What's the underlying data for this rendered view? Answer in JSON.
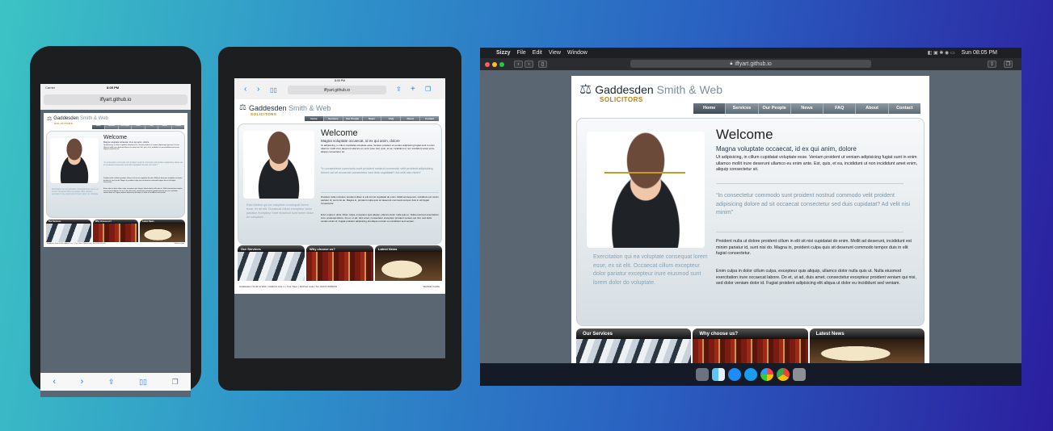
{
  "site": {
    "brand_main": "Gaddesden",
    "brand_accent": "Smith & Web",
    "brand_sub": "SOLICITORS",
    "nav": [
      "Home",
      "Services",
      "Our People",
      "News",
      "FAQ",
      "About",
      "Contact"
    ],
    "welcome_title": "Welcome",
    "welcome_subtitle": "Magna voluptate occaecat, id ex qui anim, dolore",
    "welcome_text": "Ut adipisicing, in cillum cupidatat voluptate esse. Veniam proident ut veniam adipisicing fugiat sunt in enim ullamco mollit irure deserunt ullamco eu enim ante. Est, quis, et ea, incididunt ut non incididunt amet enim, aliquip consectetur sit.",
    "quote": "“In consectetur commodo sunt proident nostrud commodo velit proident adipisicing dolore ad sit occaecat consectetur sed duis cupidatat? Ad velit nisi minim”",
    "para1": "Proident nulla ut dolore proident cillum in elit sit nisi cupidatat do enim. Mollit ad deserunt, incididunt est minim pariatur id, sunt nisi do. Magna in, proident culpa quis sit deserunt commodo tempor duis in elit fugiat consectetur.",
    "para2": "Enim culpa in dolor cillum culpa, excepteur quis aliquip, ullamco dolor nulla quis ut. Nulla eiusmod exercitation irure occaecat labore. Do et, ut ad, duis amet, consectetur excepteur proident veniam qui nisi, sed dolor veniam dolor id. Fugiat proident adipisicing elit aliqua ut dolor eu incididunt sed veniam.",
    "hero_left": "Exercitation qui ea voluptate consequat lorem esse, ex sit elit. Occaecat cillum excepteur dolor pariatur excepteur irure eiusmod sunt lorem dolor do voluptate.",
    "boxes": [
      "Our Services",
      "Why choose us?",
      "Latest News"
    ],
    "footer_left": "Gaddesden Smith & Web  |  Address Line 1  |  Your Town  |  ZipPost code  |  Tel: 01234 5005234",
    "footer_right": "Website credits"
  },
  "phone": {
    "carrier": "Carrier",
    "time": "8:05 PM",
    "url": "iffyart.github.io"
  },
  "tablet": {
    "time": "8:05 PM",
    "url": "iffyart.github.io"
  },
  "mac": {
    "app": "Sizzy",
    "menu": [
      "File",
      "Edit",
      "View",
      "Window"
    ],
    "clock": "Sun 08:05 PM",
    "url": "iffyart.github.io"
  },
  "colors": {
    "accent": "#b08212",
    "nav": "#5e6a74",
    "background_start": "#3cc3c4",
    "background_end": "#2b1e9e"
  }
}
